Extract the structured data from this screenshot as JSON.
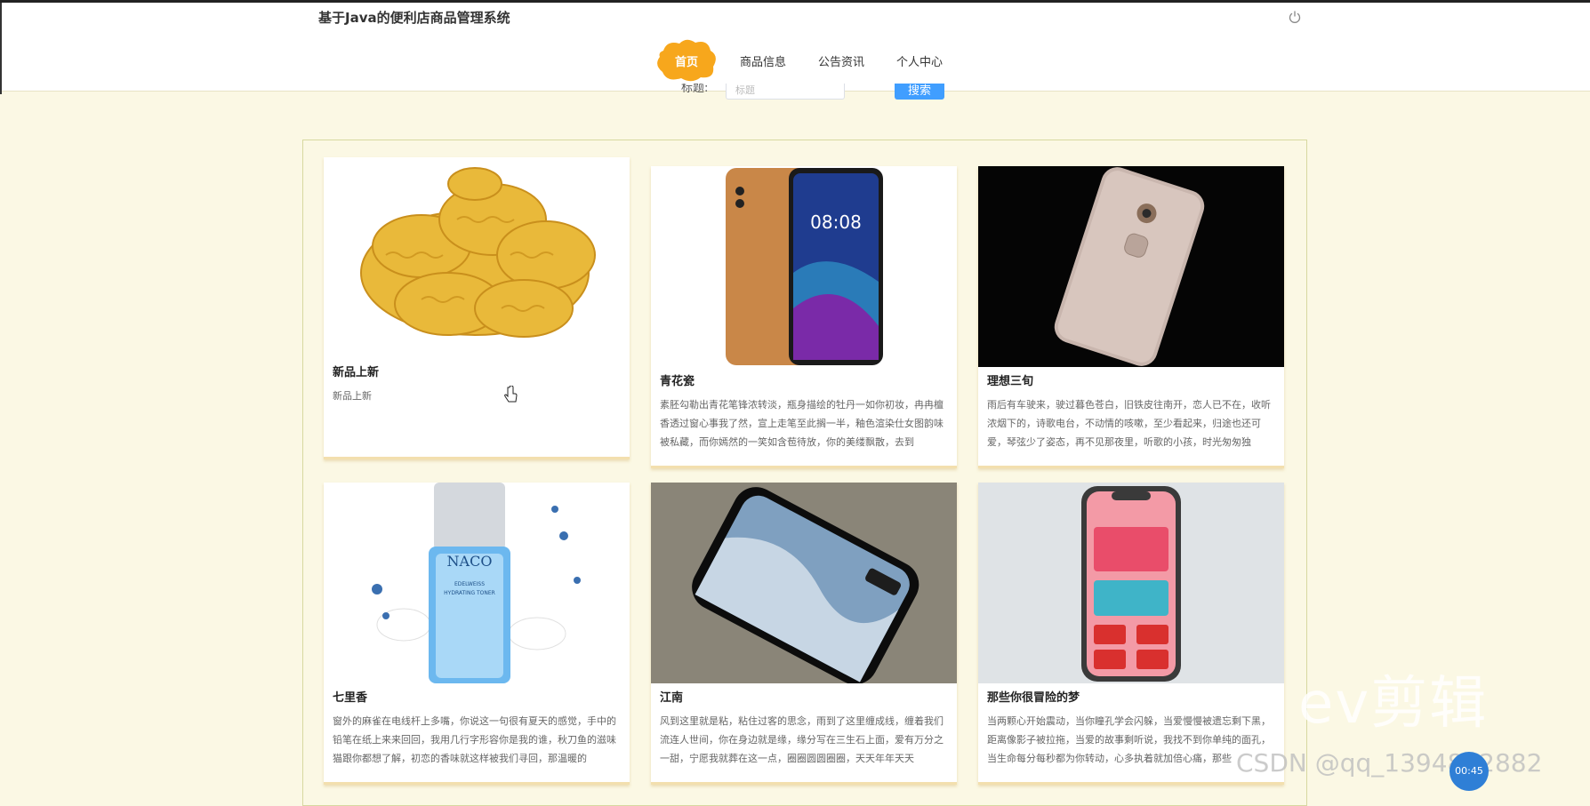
{
  "header": {
    "site_title": "基于Java的便利店商品管理系统",
    "power_icon": "power-icon"
  },
  "nav": {
    "items": [
      "首页",
      "商品信息",
      "公告资讯",
      "个人中心"
    ],
    "active_index": 0,
    "active_color": "#f7a71c"
  },
  "search": {
    "label": "标题:",
    "placeholder": "标题",
    "button_label": "搜索",
    "button_color": "#409eff"
  },
  "cards": [
    {
      "title": "新品上新",
      "desc": "新品上新",
      "image": "potato-chips-image"
    },
    {
      "title": "青花瓷",
      "desc": "素胚勾勒出青花笔锋浓转淡，瓶身描绘的牡丹一如你初妆，冉冉檀香透过窗心事我了然，宣上走笔至此搁一半，釉色渲染仕女图韵味被私藏，而你嫣然的一笑如含苞待放，你的美缕飘散，去到",
      "image": "brown-phone-image"
    },
    {
      "title": "理想三旬",
      "desc": "雨后有车驶来，驶过暮色苍白，旧铁皮往南开，恋人已不在，收听浓烟下的，诗歌电台，不动情的咳嗽，至少看起来，归途也还可爱，琴弦少了姿态，再不见那夜里，听歌的小孩，时光匆匆独",
      "image": "silver-phone-image"
    },
    {
      "title": "七里香",
      "desc": "窗外的麻雀在电线杆上多嘴，你说这一句很有夏天的感觉，手中的铅笔在纸上来来回回，我用几行字形容你是我的谁，秋刀鱼的滋味猫跟你都想了解，初恋的香味就这样被我们寻回，那温暖的",
      "image": "toner-bottle-image"
    },
    {
      "title": "江南",
      "desc": "风到这里就是粘，粘住过客的思念，雨到了这里缠成线，缠着我们流连人世间，你在身边就是缘，缘分写在三生石上面，爱有万分之一甜，宁愿我就葬在这一点，圈圈圆圆圈圈，天天年年天天",
      "image": "black-phone-image"
    },
    {
      "title": "那些你很冒险的梦",
      "desc": "当两颗心开始震动，当你瞳孔学会闪躲，当爱慢慢被遗忘剩下黑，距离像影子被拉拖，当爱的故事剩听说，我找不到你单纯的面孔，当生命每分每秒都为你转动，心多执着就加倍心痛，那些",
      "image": "iphone-image"
    }
  ],
  "overlay": {
    "watermark": "ev剪辑",
    "csdn": "CSDN @qq_1394842882",
    "badge": "00:45"
  }
}
